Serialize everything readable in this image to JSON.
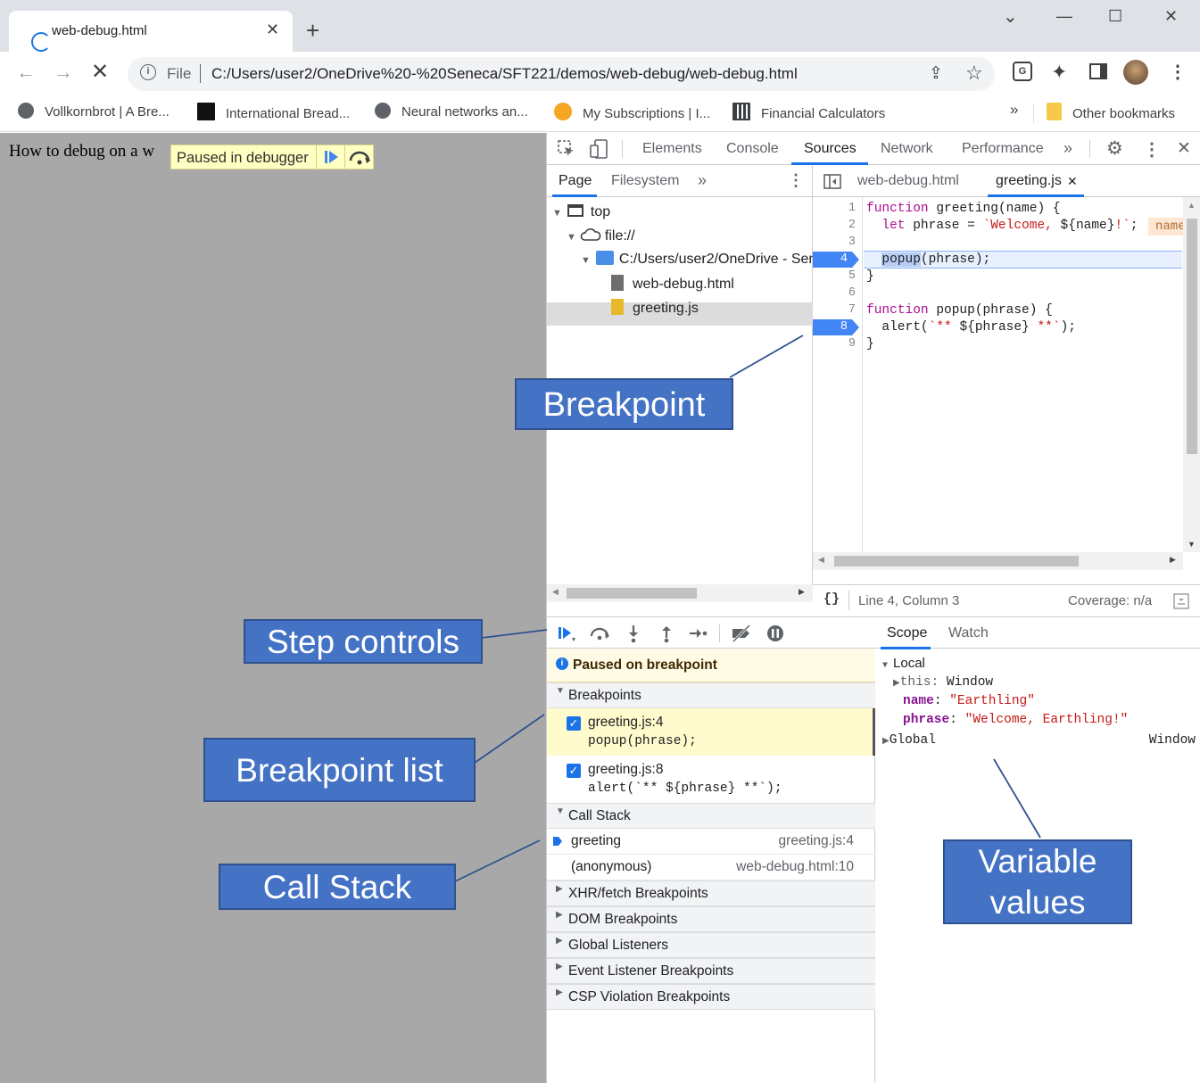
{
  "browser": {
    "tab_title": "web-debug.html",
    "tab_close": "✕",
    "new_tab": "+",
    "window_controls": {
      "dropdown": "⌄",
      "minimize": "—",
      "maximize": "☐",
      "close": "✕"
    },
    "omnibox": {
      "scheme_label": "File",
      "url": "C:/Users/user2/OneDrive%20-%20Seneca/SFT221/demos/web-debug/web-debug.html"
    },
    "bookmarks": [
      {
        "label": "Vollkornbrot | A Bre...",
        "icon": "globe-icon"
      },
      {
        "label": "International Bread...",
        "icon": "document-icon"
      },
      {
        "label": "Neural networks an...",
        "icon": "globe-icon"
      },
      {
        "label": "My Subscriptions | I...",
        "icon": "subscriptions-icon"
      },
      {
        "label": "Financial Calculators",
        "icon": "calculator-icon"
      }
    ],
    "bookmarks_overflow": "»",
    "other_bookmarks": "Other bookmarks"
  },
  "page": {
    "heading": "How to debug on a w",
    "paused_banner": "Paused in debugger"
  },
  "devtools": {
    "tabs": [
      "Elements",
      "Console",
      "Sources",
      "Network",
      "Performance"
    ],
    "active_tab": "Sources",
    "overflow": "»",
    "navigator": {
      "tabs": [
        "Page",
        "Filesystem"
      ],
      "overflow": "»",
      "tree": {
        "top": "top",
        "origin": "file://",
        "folder": "C:/Users/user2/OneDrive - Sen",
        "files": [
          "web-debug.html",
          "greeting.js"
        ]
      }
    },
    "editor": {
      "tabs": [
        "web-debug.html",
        "greeting.js"
      ],
      "active_tab": "greeting.js",
      "close_glyph": "✕",
      "line_numbers": [
        "1",
        "2",
        "3",
        "4",
        "5",
        "6",
        "7",
        "8",
        "9"
      ],
      "breakpoint_lines": [
        "4",
        "8"
      ],
      "code": {
        "l1_kw": "function",
        "l1_rest": " greeting(name) {",
        "l2_kw": "  let",
        "l2_rest": " phrase = ",
        "l2_str_a": "`Welcome, ",
        "l2_tpl": "${name}",
        "l2_str_b": "!`",
        "l2_end": ";",
        "l2_inline": "name",
        "l4_hl": "popup",
        "l4_rest": "(phrase);",
        "l5": "}",
        "l7_kw": "function",
        "l7_rest": " popup(phrase) {",
        "l8_a": "  alert(",
        "l8_str_a": "`** ",
        "l8_tpl": "${phrase}",
        "l8_str_b": " **`",
        "l8_end": ");",
        "l9": "}"
      },
      "status": {
        "format_icon": "{}",
        "position": "Line 4, Column 3",
        "coverage": "Coverage: n/a"
      }
    },
    "debugger": {
      "paused_message": "Paused on breakpoint",
      "sections": {
        "breakpoints": "Breakpoints",
        "call_stack": "Call Stack",
        "xhr": "XHR/fetch Breakpoints",
        "dom": "DOM Breakpoints",
        "global_listeners": "Global Listeners",
        "event_listeners": "Event Listener Breakpoints",
        "csp": "CSP Violation Breakpoints"
      },
      "breakpoints": [
        {
          "file": "greeting.js:4",
          "code": "popup(phrase);",
          "checked": true
        },
        {
          "file": "greeting.js:8",
          "code": "alert(`** ${phrase} **`);",
          "checked": true
        }
      ],
      "call_stack": [
        {
          "name": "greeting",
          "location": "greeting.js:4",
          "current": true
        },
        {
          "name": "(anonymous)",
          "location": "web-debug.html:10",
          "current": false
        }
      ]
    },
    "scope": {
      "tabs": [
        "Scope",
        "Watch"
      ],
      "local": "Local",
      "this_label": "this",
      "this_value": "Window",
      "vars": [
        {
          "name": "name",
          "value": "\"Earthling\""
        },
        {
          "name": "phrase",
          "value": "\"Welcome, Earthling!\""
        }
      ],
      "global": "Global",
      "global_value": "Window"
    }
  },
  "callouts": {
    "breakpoint": "Breakpoint",
    "step_controls": "Step controls",
    "breakpoint_list": "Breakpoint list",
    "call_stack": "Call Stack",
    "variable_values": "Variable values"
  },
  "colors": {
    "callout_fill": "#4472c4",
    "breakpoint_blue": "#4285f4",
    "accent": "#1a73e8",
    "paused_banner": "#ffffc2"
  }
}
